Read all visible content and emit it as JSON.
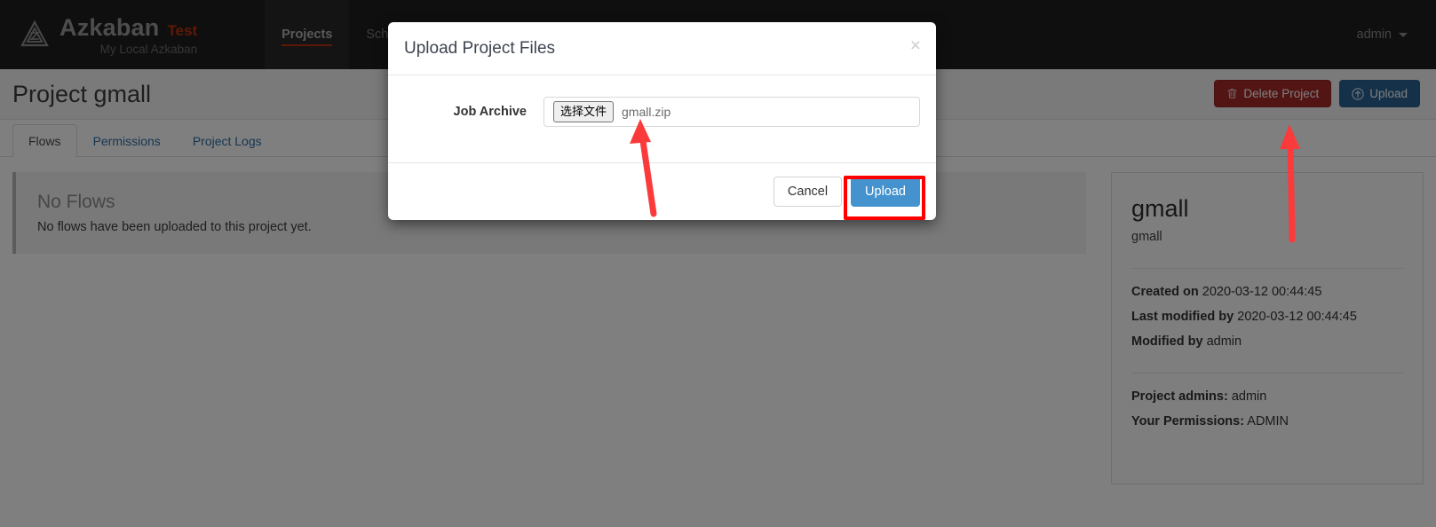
{
  "navbar": {
    "brand_name": "Azkaban",
    "brand_tag": "Test",
    "brand_sub": "My Local Azkaban",
    "logo_icon": "azkaban-triangle-logo",
    "items": [
      {
        "label": "Projects",
        "active": true
      },
      {
        "label": "Scheduling",
        "active": false
      }
    ],
    "user": "admin",
    "user_caret_icon": "caret-down-icon"
  },
  "page": {
    "title": "Project gmall",
    "delete_button": {
      "label": "Delete Project",
      "icon": "trash-icon"
    },
    "upload_button": {
      "label": "Upload",
      "icon": "upload-circle-icon"
    },
    "tabs": [
      {
        "label": "Flows",
        "active": true
      },
      {
        "label": "Permissions",
        "active": false
      },
      {
        "label": "Project Logs",
        "active": false
      }
    ],
    "no_flows": {
      "heading": "No Flows",
      "text": "No flows have been uploaded to this project yet."
    },
    "sidecard": {
      "name": "gmall",
      "description": "gmall",
      "rows": [
        {
          "label": "Created on",
          "value": "2020-03-12 00:44:45"
        },
        {
          "label": "Last modified by",
          "value": "2020-03-12 00:44:45"
        },
        {
          "label": "Modified by",
          "value": "admin"
        }
      ],
      "perm_rows": [
        {
          "label": "Project admins:",
          "value": "admin"
        },
        {
          "label": "Your Permissions:",
          "value": "ADMIN"
        }
      ]
    }
  },
  "modal": {
    "title": "Upload Project Files",
    "close_label": "×",
    "close_icon": "close-icon",
    "field_label": "Job Archive",
    "file_choose_label": "选择文件",
    "file_name": "gmall.zip",
    "cancel_label": "Cancel",
    "upload_label": "Upload"
  },
  "annotations": {
    "highlight_color": "#ff0000",
    "arrow_color": "#fb3b3b",
    "arrows": [
      {
        "name": "arrow-to-file-input"
      },
      {
        "name": "arrow-to-upload-button"
      }
    ]
  },
  "colors": {
    "navbar_bg": "#1f1f1f",
    "brand_accent": "#b8330f",
    "primary_blue": "#4593ce",
    "danger_red": "#a72b28"
  }
}
